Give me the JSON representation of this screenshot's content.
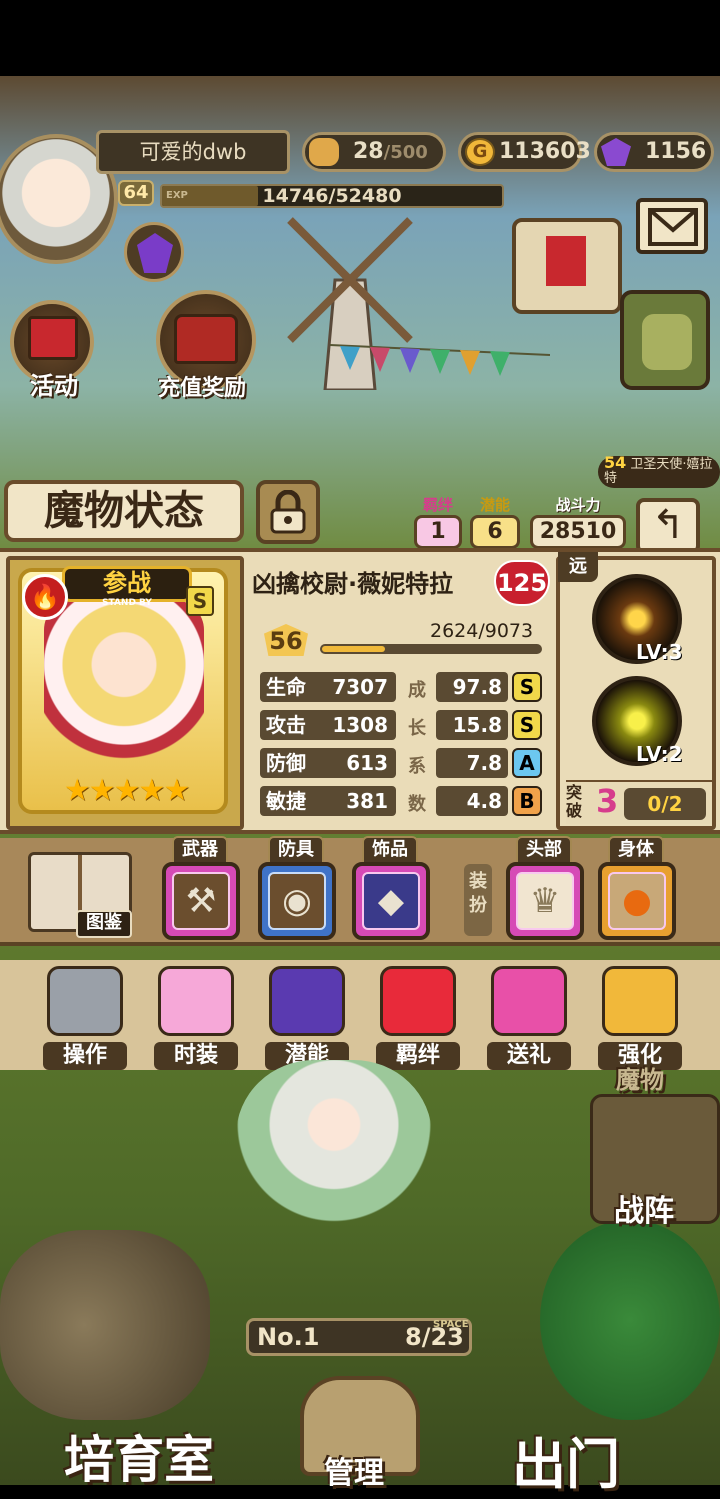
{
  "header": {
    "player_name": "可爱的dwb",
    "level": "64",
    "exp": "14746/52480",
    "exp_fraction": 0.281,
    "stamina": "28",
    "stamina_max": "/500",
    "gold": "113603",
    "gems": "1156"
  },
  "side_buttons": {
    "activity": "活动",
    "recharge_reward": "充值奖励"
  },
  "companion": {
    "level": "54",
    "name": "卫圣天使·嬉拉特"
  },
  "panel": {
    "title": "魔物状态",
    "bond_label": "羁绊",
    "bond_value": "1",
    "potential_label": "潜能",
    "potential_value": "6",
    "power_label": "战斗力",
    "power_value": "28510",
    "standby": "参战",
    "standby_sub": "STAND BY",
    "card_rank": "S",
    "stars": 5,
    "monster_name": "凶擒校尉·薇妮特拉",
    "affection": "125",
    "level": "56",
    "exp": "2624/9073",
    "exp_fraction": 0.289,
    "growth_label": [
      "成",
      "长",
      "系",
      "数"
    ],
    "stats": [
      {
        "label": "生命",
        "value": "7307",
        "growth": "97.8",
        "grade": "S",
        "grade_color": "#f1d84a"
      },
      {
        "label": "攻击",
        "value": "1308",
        "growth": "15.8",
        "grade": "S",
        "grade_color": "#f1d84a"
      },
      {
        "label": "防御",
        "value": "613",
        "growth": "7.8",
        "grade": "A",
        "grade_color": "#6cc7f0"
      },
      {
        "label": "敏捷",
        "value": "381",
        "growth": "4.8",
        "grade": "B",
        "grade_color": "#f0a24a"
      }
    ],
    "range_tag": "远",
    "skills": [
      {
        "lv": "LV:3"
      },
      {
        "lv": "LV:2"
      }
    ],
    "breakthrough_label": "突破",
    "breakthrough_level": "3",
    "breakthrough_progress": "0/2"
  },
  "equip": {
    "codex": "图鉴",
    "weapon": "武器",
    "armor": "防具",
    "accessory": "饰品",
    "dress_up": "装扮",
    "head": "头部",
    "body": "身体"
  },
  "actions": [
    "操作",
    "时装",
    "潜能",
    "羁绊",
    "送礼",
    "强化"
  ],
  "farm": {
    "no_label": "No.",
    "no_value": "1",
    "space_label": "SPACE",
    "space": "8/23",
    "monster_sign": "魔物",
    "formation": "战阵",
    "nursery": "培育室",
    "manage": "管理",
    "go_out": "出门"
  },
  "colors": {
    "panel_bg": "#eadcb8",
    "frame": "#6a4c2b",
    "gold": "#f0b93a",
    "slot_pink": "#d64ab6",
    "slot_blue": "#3f73c8",
    "slot_orange": "#e8a030"
  }
}
